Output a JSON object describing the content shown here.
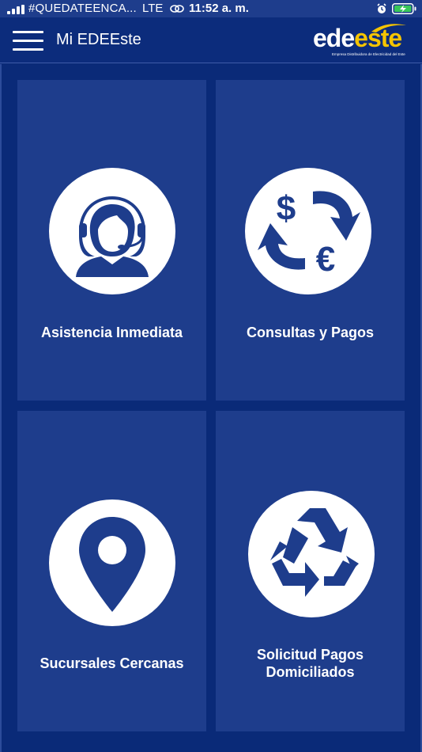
{
  "status_bar": {
    "carrier": "#QUEDATEENCA...",
    "network": "LTE",
    "time": "11:52 a. m."
  },
  "app_bar": {
    "title": "Mi EDEEste",
    "logo": {
      "ede": "ede",
      "este": "este",
      "tagline": "Empresa Distribuidora de Electricidad del Este"
    }
  },
  "tiles": [
    {
      "label": "Asistencia Inmediata",
      "icon": "headset-agent-icon"
    },
    {
      "label": "Consultas y Pagos",
      "icon": "currency-exchange-icon"
    },
    {
      "label": "Sucursales Cercanas",
      "icon": "location-pin-icon"
    },
    {
      "label_line1": "Solicitud Pagos",
      "label_line2": "Domiciliados",
      "icon": "recycle-icon"
    }
  ],
  "colors": {
    "background": "#0a2a78",
    "tile": "#1e3d8c",
    "icon": "#1e3d8c",
    "accent": "#f5c400"
  }
}
